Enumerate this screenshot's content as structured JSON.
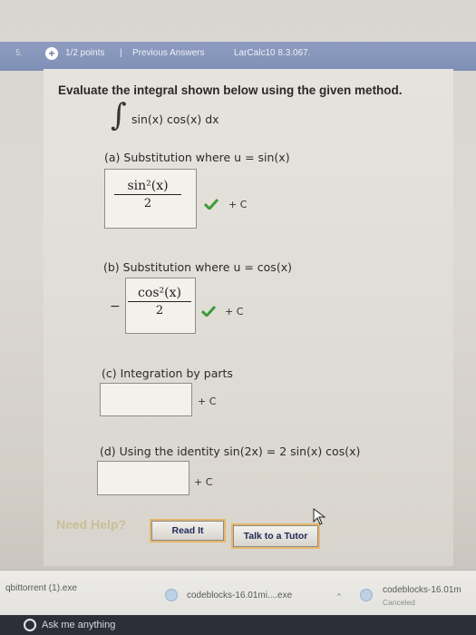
{
  "header": {
    "question_number": "5.",
    "points": "1/2 points",
    "separator": "|",
    "previous_answers": "Previous Answers",
    "source": "LarCalc10 8.3.067."
  },
  "question": {
    "prompt": "Evaluate the integral shown below using the given method.",
    "integral_sign": "∫",
    "integrand": "sin(x) cos(x) dx"
  },
  "parts": {
    "a": {
      "label": "(a) Substitution where u = sin(x)",
      "numerator": "sin²(x)",
      "denominator": "2",
      "constant": "+ C",
      "status": "correct"
    },
    "b": {
      "label": "(b) Substitution where u = cos(x)",
      "sign": "−",
      "numerator": "cos²(x)",
      "denominator": "2",
      "constant": "+ C",
      "status": "correct"
    },
    "c": {
      "label": "(c) Integration by parts",
      "value": "",
      "constant": "+ C"
    },
    "d": {
      "label": "(d) Using the identity sin(2x) = 2 sin(x) cos(x)",
      "value": "",
      "constant": "+ C"
    }
  },
  "help": {
    "label": "Need Help?",
    "read_it": "Read It",
    "talk_to_tutor": "Talk to a Tutor"
  },
  "downloads": {
    "items": [
      {
        "name": "qbittorrent (1).exe"
      },
      {
        "name": "codeblocks-16.01mi....exe"
      },
      {
        "name": "codeblocks-16.01m",
        "status": "Canceled"
      }
    ]
  },
  "taskbar": {
    "search_placeholder": "Ask me anything"
  },
  "colors": {
    "header_band": "#8e9cc0",
    "check_green": "#3f9a3a",
    "need_help": "#c8bf96"
  }
}
